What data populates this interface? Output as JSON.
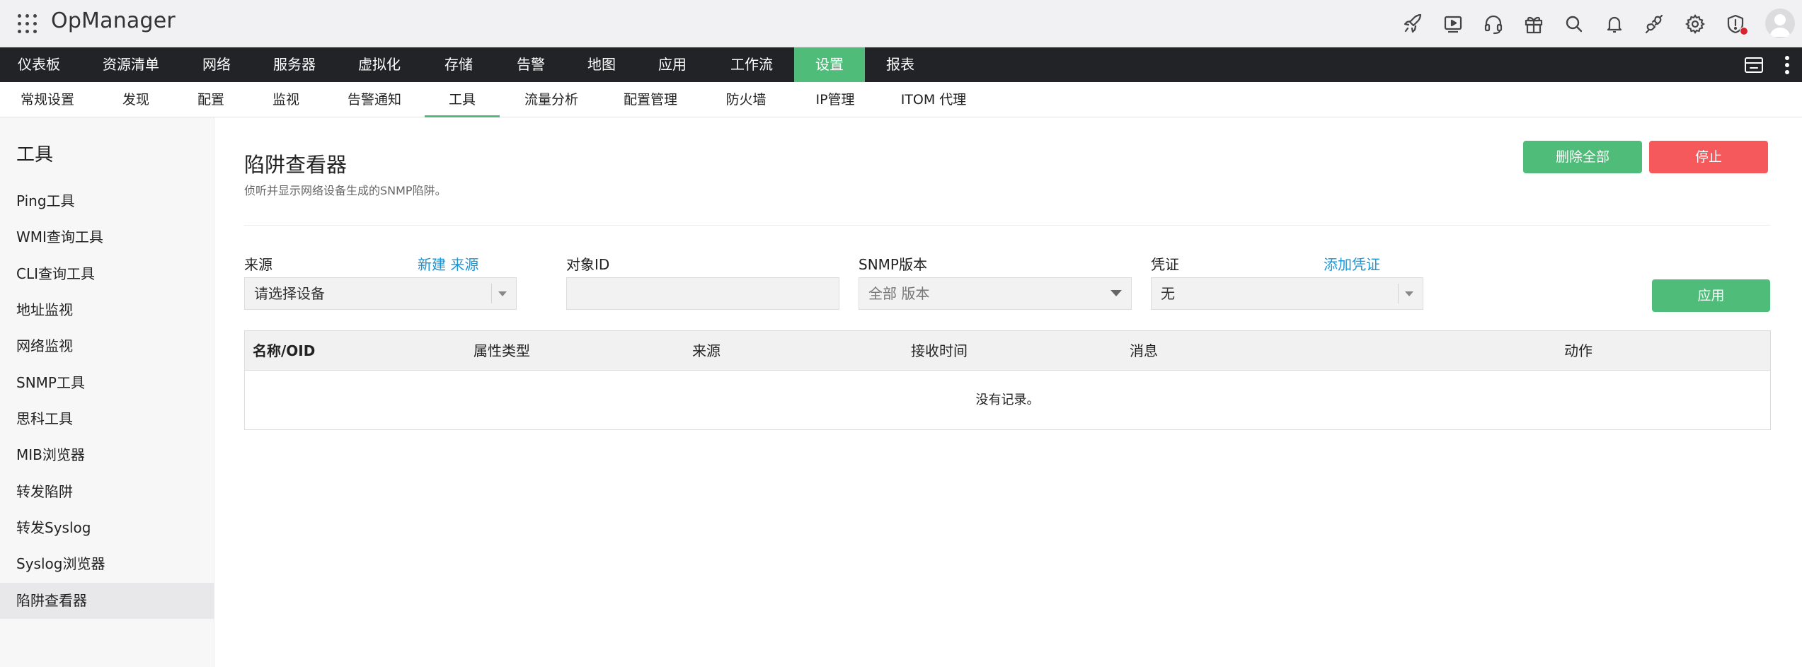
{
  "header": {
    "app_name": "OpManager",
    "icons": [
      "rocket-icon",
      "video-icon",
      "headset-icon",
      "gift-icon",
      "search-icon",
      "bell-icon",
      "plug-icon",
      "gear-icon",
      "shield-alert-icon"
    ]
  },
  "main_nav": {
    "items": [
      {
        "label": "仪表板"
      },
      {
        "label": "资源清单"
      },
      {
        "label": "网络"
      },
      {
        "label": "服务器"
      },
      {
        "label": "虚拟化"
      },
      {
        "label": "存储"
      },
      {
        "label": "告警"
      },
      {
        "label": "地图"
      },
      {
        "label": "应用"
      },
      {
        "label": "工作流"
      },
      {
        "label": "设置"
      },
      {
        "label": "报表"
      }
    ],
    "active": "设置"
  },
  "sub_nav": {
    "items": [
      {
        "label": "常规设置"
      },
      {
        "label": "发现"
      },
      {
        "label": "配置"
      },
      {
        "label": "监视"
      },
      {
        "label": "告警通知"
      },
      {
        "label": "工具"
      },
      {
        "label": "流量分析"
      },
      {
        "label": "配置管理"
      },
      {
        "label": "防火墙"
      },
      {
        "label": "IP管理"
      },
      {
        "label": "ITOM 代理"
      }
    ],
    "active": "工具"
  },
  "sidebar": {
    "title": "工具",
    "items": [
      {
        "label": "Ping工具"
      },
      {
        "label": "WMI查询工具"
      },
      {
        "label": "CLI查询工具"
      },
      {
        "label": "地址监视"
      },
      {
        "label": "网络监视"
      },
      {
        "label": "SNMP工具"
      },
      {
        "label": "思科工具"
      },
      {
        "label": "MIB浏览器"
      },
      {
        "label": "转发陷阱"
      },
      {
        "label": "转发Syslog"
      },
      {
        "label": "Syslog浏览器"
      },
      {
        "label": "陷阱查看器"
      }
    ],
    "active": "陷阱查看器"
  },
  "page": {
    "title": "陷阱查看器",
    "description": "侦听并显示网络设备生成的SNMP陷阱。",
    "delete_all_label": "删除全部",
    "stop_label": "停止",
    "apply_label": "应用"
  },
  "filters": {
    "source": {
      "label": "来源",
      "link": "新建 来源",
      "value": "请选择设备"
    },
    "object_id": {
      "label": "对象ID",
      "value": ""
    },
    "snmp_version": {
      "label": "SNMP版本",
      "value": "全部 版本"
    },
    "credential": {
      "label": "凭证",
      "link": "添加凭证",
      "value": "无"
    }
  },
  "table": {
    "columns": [
      "名称/OID",
      "属性类型",
      "来源",
      "接收时间",
      "消息",
      "动作"
    ],
    "empty_text": "没有记录。"
  },
  "colors": {
    "accent_green": "#4fbd79",
    "danger_red": "#f5595b",
    "nav_dark": "#222326",
    "link_blue": "#1a95d6"
  }
}
